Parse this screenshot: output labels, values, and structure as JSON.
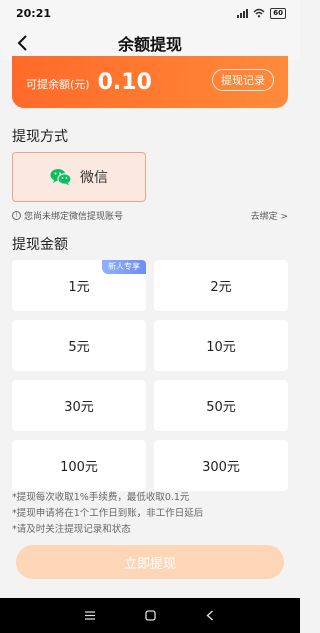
{
  "status_bar": {
    "time": "20:21",
    "battery": "60"
  },
  "header": {
    "title": "余额提现"
  },
  "balance": {
    "label": "可提余额(元)",
    "value": "0.10",
    "history_button": "提现记录"
  },
  "method_section": {
    "title": "提现方式",
    "option_label": "微信",
    "notice": "您尚未绑定微信提现账号",
    "bind_link": "去绑定 >"
  },
  "amount_section": {
    "title": "提现金额",
    "badge": "新人专享",
    "options": [
      {
        "label": "1元"
      },
      {
        "label": "2元"
      },
      {
        "label": "5元"
      },
      {
        "label": "10元"
      },
      {
        "label": "30元"
      },
      {
        "label": "50元"
      },
      {
        "label": "100元"
      },
      {
        "label": "300元"
      }
    ]
  },
  "notes": [
    "*提现每次收取1%手续费，最低收取0.1元",
    "*提现申请将在1个工作日到账，非工作日延后",
    "*请及时关注提现记录和状态"
  ],
  "submit": {
    "label": "立即提现"
  },
  "colors": {
    "accent": "#ff7a30",
    "method_bg": "#fbe9e1",
    "submit_disabled": "#fdd6b7",
    "wechat_green": "#07c160"
  }
}
